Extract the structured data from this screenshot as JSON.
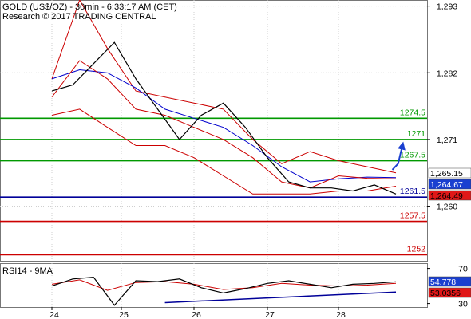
{
  "chart_data": {
    "type": "line",
    "title": "GOLD (US$/OZ) - 30min - 6:33:17 AM (CET)",
    "subtitle": "Research © 2017 TRADING CENTRAL",
    "x_ticks": [
      "24",
      "25",
      "26",
      "27",
      "28"
    ],
    "price_panel": {
      "ylim": [
        1251,
        1294
      ],
      "y_ticks": [
        {
          "value": 1293,
          "label": "1,293"
        },
        {
          "value": 1282,
          "label": "1,282"
        },
        {
          "value": 1271,
          "label": "1,271"
        },
        {
          "value": 1260,
          "label": "1,260"
        }
      ],
      "levels": [
        {
          "value": 1274.5,
          "label": "1274.5",
          "color": "#009900"
        },
        {
          "value": 1271,
          "label": "1271",
          "color": "#009900"
        },
        {
          "value": 1267.5,
          "label": "1267.5",
          "color": "#009900"
        },
        {
          "value": 1261.5,
          "label": "1261.5",
          "color": "#000099"
        },
        {
          "value": 1257.5,
          "label": "1257.5",
          "color": "#cc0000"
        },
        {
          "value": 1252,
          "label": "1252",
          "color": "#cc0000"
        }
      ],
      "price_tags": [
        {
          "value": 1265.15,
          "label": "1,265.15",
          "bg": "#ffffff",
          "fg": "#000000"
        },
        {
          "value": 1264.67,
          "label": "1,264.67",
          "bg": "#1a3fd0",
          "fg": "#ffffff"
        },
        {
          "value": 1264.49,
          "label": "1,264.49",
          "bg": "#e01818",
          "fg": "#000000"
        }
      ],
      "series": [
        {
          "color": "#000000",
          "x": [
            0,
            0.3,
            0.6,
            0.9,
            1.2,
            1.5,
            1.8,
            2.1,
            2.4,
            2.7,
            3.0,
            3.3,
            3.6,
            3.9,
            4.2,
            4.5,
            4.8
          ],
          "values": [
            1279,
            1280,
            1283.5,
            1287,
            1281,
            1276,
            1271,
            1275,
            1277,
            1273,
            1268,
            1264,
            1263,
            1263,
            1262.5,
            1263.5,
            1262,
            1266,
            1262,
            1264,
            1265
          ]
        },
        {
          "color": "#0000cc",
          "x": [
            0,
            0.4,
            0.8,
            1.2,
            1.6,
            2.0,
            2.4,
            2.8,
            3.2,
            3.6,
            4.0,
            4.4,
            4.8
          ],
          "values": [
            1281,
            1282.5,
            1282,
            1279.5,
            1276,
            1274.5,
            1273,
            1270,
            1266.5,
            1264,
            1264.5,
            1264.8,
            1264.7
          ]
        },
        {
          "color": "#cc0000",
          "x": [
            0,
            0.4,
            0.8,
            1.2,
            1.6,
            2.0,
            2.4,
            2.8,
            3.2,
            3.6,
            4.0,
            4.4,
            4.8
          ],
          "values": [
            1278,
            1284,
            1281,
            1276,
            1275,
            1273,
            1271,
            1268,
            1264,
            1263,
            1265,
            1264.6,
            1264.5
          ]
        },
        {
          "color": "#cc0000",
          "x": [
            0,
            0.4,
            0.8,
            1.2,
            1.6,
            2.0,
            2.4,
            2.8,
            3.2,
            3.6,
            4.0,
            4.4,
            4.8
          ],
          "values": [
            1281,
            1294,
            1286,
            1279,
            1278,
            1277,
            1276,
            1271,
            1267,
            1269,
            1267.5,
            1266.5,
            1265.5
          ]
        },
        {
          "color": "#cc0000",
          "x": [
            0,
            0.4,
            0.8,
            1.2,
            1.6,
            2.0,
            2.4,
            2.8,
            3.2,
            3.6,
            4.0,
            4.4,
            4.8
          ],
          "values": [
            1275,
            1276,
            1273,
            1270,
            1270,
            1268,
            1265,
            1262,
            1262,
            1262,
            1262.5,
            1262.5,
            1263.3
          ]
        },
        {
          "color": "#1a3fd0",
          "x": [
            4.75,
            4.83,
            4.89
          ],
          "values": [
            1266,
            1267,
            1270
          ]
        }
      ]
    },
    "rsi_panel": {
      "label": "RSI14 - 9MA",
      "ylim": [
        26,
        76
      ],
      "y_ticks": [
        {
          "value": 70,
          "label": "70"
        },
        {
          "value": 30,
          "label": "30"
        }
      ],
      "tags": [
        {
          "value": 54.778,
          "label": "54.778",
          "bg": "#1a3fd0",
          "fg": "#ffffff"
        },
        {
          "value": 53.056,
          "label": "53.0356",
          "bg": "#e01818",
          "fg": "#000000"
        }
      ],
      "series": [
        {
          "color": "#000000",
          "x": [
            0,
            0.3,
            0.6,
            0.9,
            1.2,
            1.5,
            1.8,
            2.1,
            2.4,
            2.7,
            3.0,
            3.3,
            3.6,
            3.9,
            4.2,
            4.5,
            4.8
          ],
          "values": [
            50,
            58,
            60,
            28,
            56,
            55,
            58,
            48,
            42,
            47,
            53,
            56,
            52,
            48,
            52,
            53,
            54.8
          ]
        },
        {
          "color": "#cc0000",
          "x": [
            0,
            0.4,
            0.8,
            1.2,
            1.6,
            2.0,
            2.4,
            2.8,
            3.2,
            3.6,
            4.0,
            4.4,
            4.8
          ],
          "values": [
            52,
            57,
            45,
            54,
            55,
            52,
            46,
            48,
            53,
            51,
            50,
            51,
            53
          ]
        },
        {
          "color": "#000099",
          "x": [
            1.6,
            4.8
          ],
          "values": [
            31,
            43
          ]
        }
      ]
    }
  }
}
